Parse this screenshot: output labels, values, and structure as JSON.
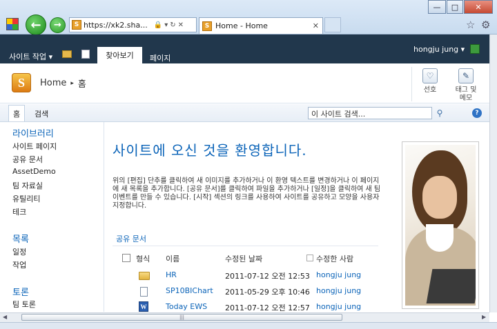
{
  "browser": {
    "address": "https://xk2.sha...",
    "tab_title": "Home - Home",
    "address_icons": [
      "lock-icon",
      "dropdown-icon",
      "refresh-icon",
      "stop-icon"
    ]
  },
  "ribbon": {
    "site_actions": "사이트 작업",
    "tab_browse": "찾아보기",
    "tab_page": "페이지",
    "user": "hongju jung"
  },
  "title": {
    "home": "Home",
    "separator": "▸",
    "current": "홈"
  },
  "tools": {
    "like": "선호",
    "tags_notes_line1": "태그 및",
    "tags_notes_line2": "메모"
  },
  "topnav": {
    "home": "홈",
    "search_link": "검색",
    "search_placeholder": "이 사이트 검색..."
  },
  "leftnav": {
    "libraries": {
      "heading": "라이브러리",
      "items": [
        "사이트 페이지",
        "공유 문서",
        "AssetDemo",
        "팀 자료실",
        "유틸리티",
        "테크"
      ]
    },
    "lists": {
      "heading": "목록",
      "items": [
        "일정",
        "작업"
      ]
    },
    "discussions": {
      "heading": "토론",
      "items": [
        "팀 토론"
      ]
    }
  },
  "main": {
    "welcome": "사이트에 오신 것을 환영합니다.",
    "paragraph": "위의 [편집] 단추를 클릭하여 새 이미지를 추가하거나 이 환영 텍스트를 변경하거나 이 페이지에 새 목록을 추가합니다. [공유 문서]를 클릭하여 파일을 추가하거나 [일정]을 클릭하여 새 팀 이벤트를 만들 수 있습니다. [시작] 섹션의 링크를 사용하여 사이트를 공유하고 모양을 사용자 지정합니다.",
    "doc_section": "공유 문서",
    "columns": {
      "type": "형식",
      "name": "이름",
      "modified": "수정된 날짜",
      "modified_by": "수정한 사람"
    },
    "rows": [
      {
        "icon": "folder-icon",
        "name": "HR",
        "modified": "2011-07-12 오전 12:53",
        "by": "hongju jung"
      },
      {
        "icon": "file-icon",
        "name": "SP10BIChart",
        "modified": "2011-05-29 오후 10:46",
        "by": "hongju jung"
      },
      {
        "icon": "word-doc-icon",
        "name": "Today EWS",
        "modified": "2011-07-12 오전 12:57",
        "by": "hongju jung"
      }
    ]
  },
  "scroll": {
    "thumb_grip": "|||"
  }
}
